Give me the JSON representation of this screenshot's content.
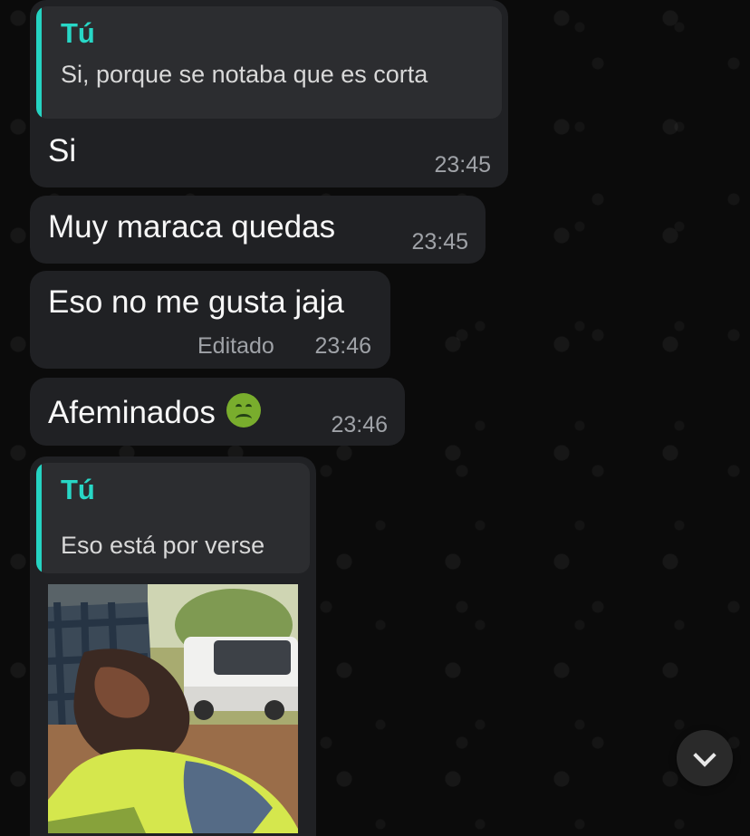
{
  "messages": [
    {
      "reply_author": "Tú",
      "reply_text": "Si, porque se notaba que es corta",
      "text": "Si",
      "time": "23:45"
    },
    {
      "text": "Muy maraca quedas",
      "time": "23:45"
    },
    {
      "text": "Eso no me gusta jaja",
      "edited": "Editado",
      "time": "23:46"
    },
    {
      "text": "Afeminados",
      "emoji": "nauseated-face-icon",
      "time": "23:46"
    },
    {
      "reply_author": "Tú",
      "reply_text": "Eso está por verse",
      "media": "gif-preview"
    }
  ],
  "colors": {
    "background": "#0b0b0b",
    "bubble": "#202124",
    "quote_accent": "#25d3c2",
    "text": "#f7f7f7",
    "meta": "#9fa2a7"
  },
  "scroll_button": {
    "icon": "chevron-down-icon"
  }
}
